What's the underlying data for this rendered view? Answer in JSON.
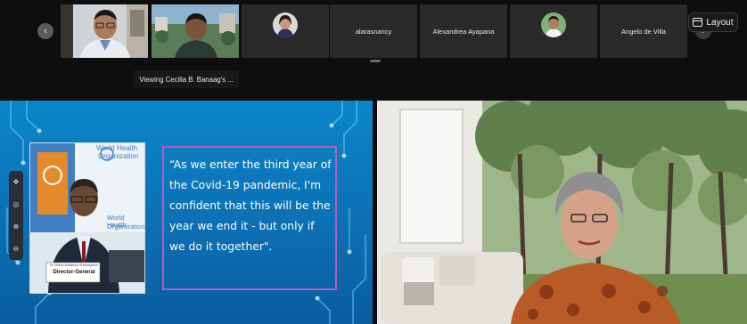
{
  "participants": [
    {
      "name": "alarasnancy"
    },
    {
      "name": "Alexandrea Ayapana"
    },
    {
      "name": "Angelo de Villa"
    }
  ],
  "viewing_label": "Viewing Cecilia B. Banaag's ...",
  "layout_button": {
    "label": "Layout"
  },
  "shared_screen": {
    "quote": "“As we enter the third year of the Covid-19 pandemic, I'm confident that this will be the year we end it - but only if we do it together\".",
    "video": {
      "backdrop_text_1": "World Health",
      "backdrop_text_2": "Organization",
      "nameplate_name": "Dr Tedros Adhanom Ghebreyesus",
      "nameplate_title": "Director-General"
    }
  },
  "icons": {
    "prev": "chevron-left-icon",
    "next": "chevron-right-icon",
    "layout": "layout-icon"
  },
  "colors": {
    "slide_background": "#0a86c9",
    "quote_border": "#b15fc6",
    "strip_background": "#0e0e0e"
  }
}
